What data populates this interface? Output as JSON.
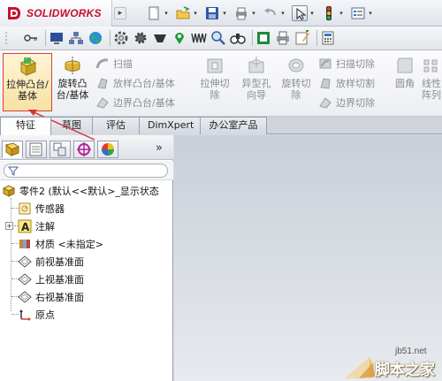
{
  "app": {
    "brand": "SOLIDWORKS",
    "brand_prefix": "S",
    "brand_rest": "OLIDWORKS"
  },
  "ribbon": {
    "extrude_boss": "拉伸凸台/基体",
    "revolve_boss": "旋转凸台/基体",
    "sweep": "扫描",
    "loft_boss": "放样凸台/基体",
    "boundary_boss": "边界凸台/基体",
    "extrude_cut": "拉伸切除",
    "hole_wizard": "异型孔向导",
    "revolve_cut": "旋转切除",
    "swept_cut": "扫描切除",
    "lofted_cut": "放样切割",
    "boundary_cut": "边界切除",
    "fillet": "圆角",
    "linear_pattern": "线性阵列"
  },
  "tabs": [
    "特征",
    "草图",
    "评估",
    "DimXpert",
    "办公室产品"
  ],
  "pane": {
    "more": "»",
    "tree": [
      {
        "label": "零件2  (默认<<默认>_显示状态"
      },
      {
        "label": "传感器"
      },
      {
        "label": "注解"
      },
      {
        "label": "材质 <未指定>"
      },
      {
        "label": "前视基准面"
      },
      {
        "label": "上视基准面"
      },
      {
        "label": "右视基准面"
      },
      {
        "label": "原点"
      }
    ]
  },
  "watermark": {
    "site": "jb51.net",
    "text": "脚本之家"
  },
  "colors": {
    "brand_red": "#c8102e",
    "highlight_border": "#e03b3b",
    "arrow": "#e0303a",
    "graphics_top": "#c9cfd8",
    "graphics_bottom": "#e7eaee"
  },
  "icons": {
    "toolbar": [
      "new-icon",
      "open-icon",
      "save-icon",
      "print-icon",
      "undo-icon",
      "select-icon",
      "rebuild-icon",
      "options-icon"
    ],
    "toolbar2": [
      "key-icon",
      "monitor-icon",
      "network-icon",
      "globe-icon",
      "gear-icon",
      "cog-icon",
      "bowl-icon",
      "pin-icon",
      "waves-icon",
      "magnifier-icon",
      "binoculars-icon",
      "sheet-icon",
      "printer-icon",
      "edit-icon",
      "calc-icon"
    ]
  }
}
